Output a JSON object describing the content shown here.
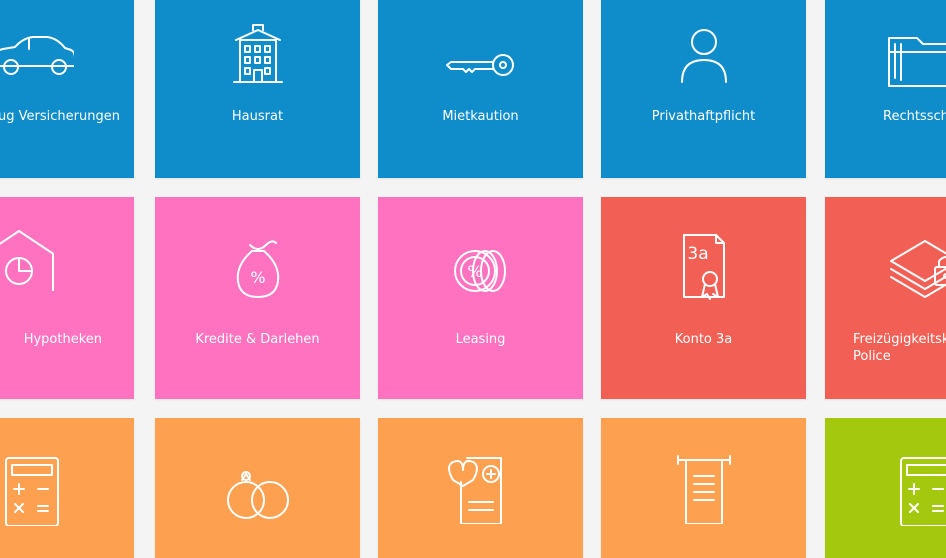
{
  "tiles": {
    "row1": [
      {
        "label": "...ug Versicherungen",
        "icon": "car-icon",
        "color": "#0f8dca"
      },
      {
        "label": "Hausrat",
        "icon": "building-icon",
        "color": "#0f8dca"
      },
      {
        "label": "Mietkaution",
        "icon": "key-icon",
        "color": "#0f8dca"
      },
      {
        "label": "Privathaftpflicht",
        "icon": "person-icon",
        "color": "#0f8dca"
      },
      {
        "label": "Rechtssch...",
        "icon": "folder-icon",
        "color": "#0f8dca"
      }
    ],
    "row2": [
      {
        "label": "Hypotheken",
        "icon": "house-chart-icon",
        "color": "#fe72c0"
      },
      {
        "label": "Kredite & Darlehen",
        "icon": "money-bag-icon",
        "color": "#fe72c0"
      },
      {
        "label": "Leasing",
        "icon": "coins-icon",
        "color": "#fe72c0"
      },
      {
        "label": "Konto 3a",
        "icon": "certificate-icon",
        "color": "#f26055",
        "icon_text": "3a"
      },
      {
        "label": "Freizügigkeitsk...\nPolice",
        "icon": "money-lock-icon",
        "color": "#f26055"
      }
    ],
    "row3": [
      {
        "label": "",
        "icon": "calculator-icon",
        "color": "#fda050"
      },
      {
        "label": "",
        "icon": "rings-icon",
        "color": "#fda050"
      },
      {
        "label": "",
        "icon": "health-document-icon",
        "color": "#fda050"
      },
      {
        "label": "",
        "icon": "scroll-icon",
        "color": "#fda050"
      },
      {
        "label": "",
        "icon": "calculator-icon",
        "color": "#a4c80d"
      }
    ]
  }
}
